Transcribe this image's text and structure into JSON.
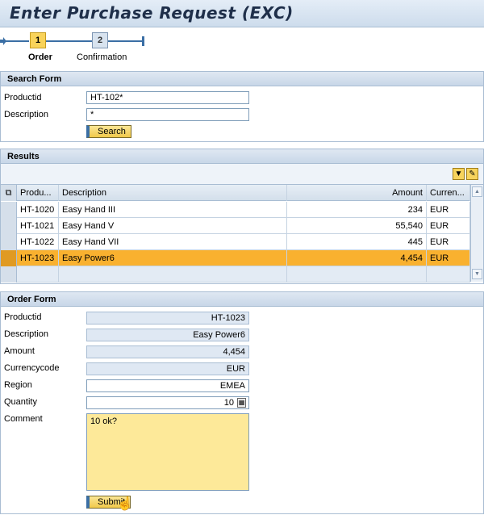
{
  "title": "Enter Purchase Request (EXC)",
  "roadmap": {
    "steps": [
      {
        "number": "1",
        "label": "Order"
      },
      {
        "number": "2",
        "label": "Confirmation"
      }
    ]
  },
  "search_form": {
    "header": "Search Form",
    "productid_label": "Productid",
    "productid_value": "HT-102*",
    "description_label": "Description",
    "description_value": "*",
    "search_button": "Search"
  },
  "results": {
    "header": "Results",
    "columns": [
      "Produ...",
      "Description",
      "Amount",
      "Curren..."
    ],
    "rows": [
      {
        "id": "HT-1020",
        "description": "Easy Hand III",
        "amount": "234",
        "currency": "EUR"
      },
      {
        "id": "HT-1021",
        "description": "Easy Hand V",
        "amount": "55,540",
        "currency": "EUR"
      },
      {
        "id": "HT-1022",
        "description": "Easy Hand VII",
        "amount": "445",
        "currency": "EUR"
      },
      {
        "id": "HT-1023",
        "description": "Easy Power6",
        "amount": "4,454",
        "currency": "EUR"
      }
    ]
  },
  "order_form": {
    "header": "Order Form",
    "productid_label": "Productid",
    "productid_value": "HT-1023",
    "description_label": "Description",
    "description_value": "Easy Power6",
    "amount_label": "Amount",
    "amount_value": "4,454",
    "currency_label": "Currencycode",
    "currency_value": "EUR",
    "region_label": "Region",
    "region_value": "EMEA",
    "quantity_label": "Quantity",
    "quantity_value": "10",
    "comment_label": "Comment",
    "comment_value": "10 ok?",
    "submit_button": "Submit"
  },
  "colors": {
    "accent": "#3b6fa5",
    "selected_row": "#f9b12f",
    "button": "#f0c94b",
    "comment_bg": "#fde999"
  }
}
